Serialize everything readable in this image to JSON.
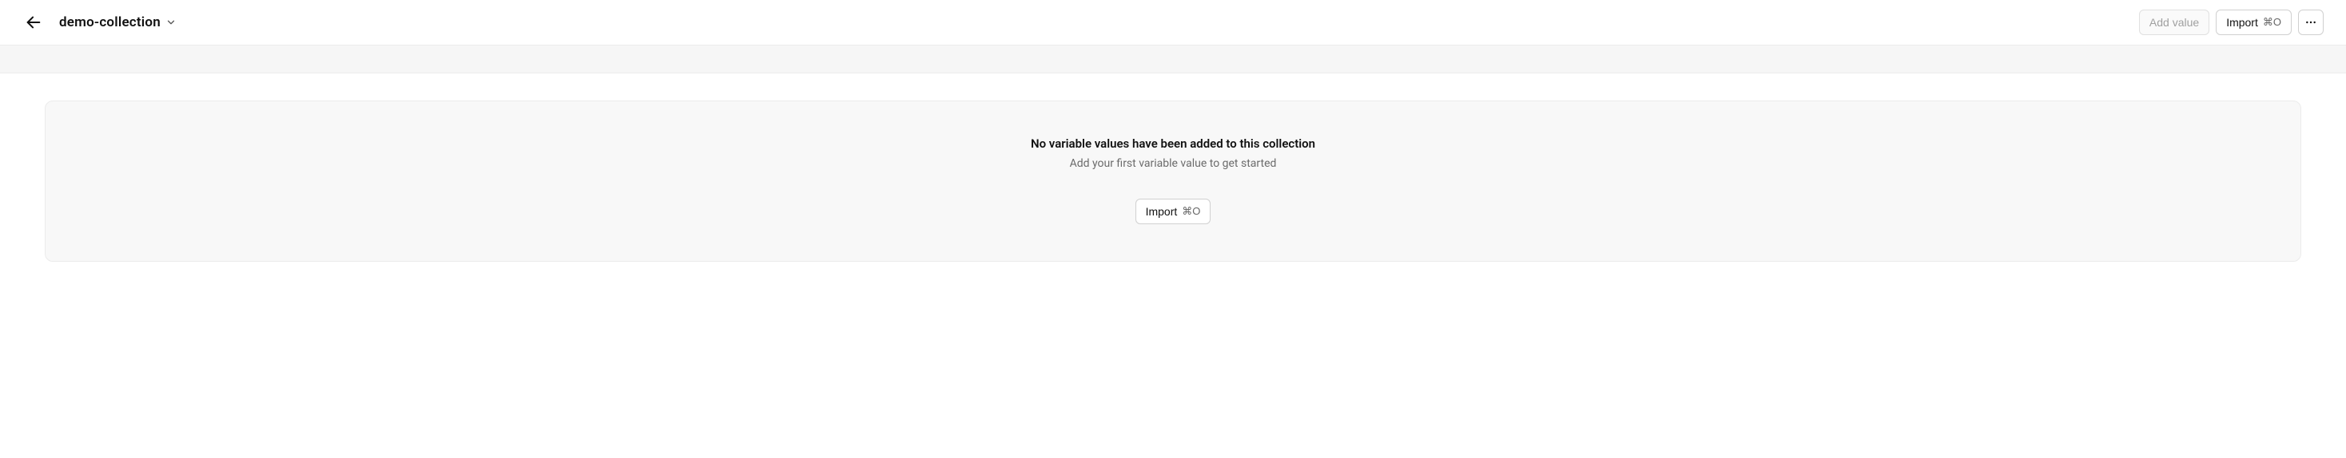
{
  "header": {
    "title": "demo-collection",
    "add_value_label": "Add value",
    "import_label": "Import",
    "import_shortcut": "⌘O"
  },
  "empty_state": {
    "title": "No variable values have been added to this collection",
    "subtitle": "Add your first variable value to get started",
    "import_label": "Import",
    "import_shortcut": "⌘O"
  }
}
